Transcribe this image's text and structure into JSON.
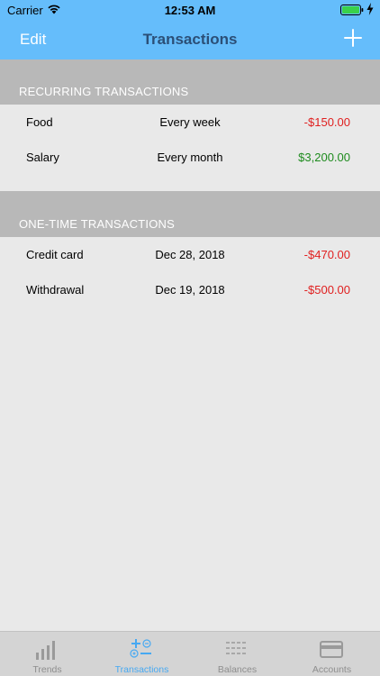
{
  "status": {
    "carrier": "Carrier",
    "time": "12:53 AM",
    "icons": [
      "wifi-icon",
      "battery-icon",
      "charging-bolt-icon"
    ]
  },
  "nav": {
    "edit_label": "Edit",
    "title": "Transactions",
    "add_icon": "plus-icon"
  },
  "recurring": {
    "header": "RECURRING TRANSACTIONS",
    "rows": [
      {
        "name": "Food",
        "frequency": "Every week",
        "amount": "-$150.00"
      },
      {
        "name": "Salary",
        "frequency": "Every month",
        "amount": "$3,200.00"
      }
    ]
  },
  "one_time": {
    "header": "ONE-TIME TRANSACTIONS",
    "rows": [
      {
        "name": "Credit card",
        "date": "Dec 28, 2018",
        "amount": "-$470.00"
      },
      {
        "name": "Withdrawal",
        "date": "Dec 19, 2018",
        "amount": "-$500.00"
      }
    ]
  },
  "colors": {
    "nav_background": "#65bdfb",
    "nav_title": "#2b4f77",
    "negative": "#e02020",
    "positive": "#1e8b1e",
    "tab_active": "#47a9f2",
    "tab_inactive": "#8e8e8e"
  },
  "tabs": [
    {
      "label": "Trends",
      "icon": "bar-chart-icon",
      "active": false
    },
    {
      "label": "Transactions",
      "icon": "plus-minus-icon",
      "active": true
    },
    {
      "label": "Balances",
      "icon": "list-icon",
      "active": false
    },
    {
      "label": "Accounts",
      "icon": "card-icon",
      "active": false
    }
  ]
}
